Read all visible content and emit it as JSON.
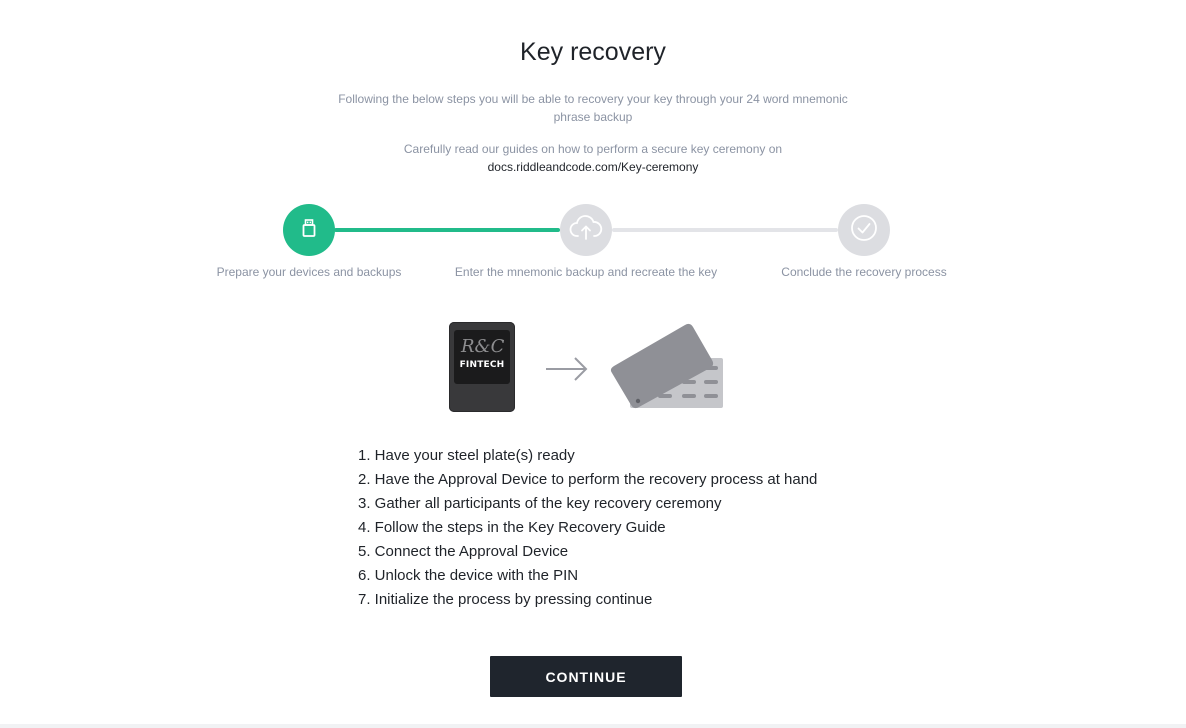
{
  "header": {
    "title": "Key recovery",
    "subtitle": "Following the below steps you will be able to recovery your key through your 24 word mnemonic phrase backup",
    "guide_text": "Carefully read our guides on how to perform a secure key ceremony on",
    "guide_link": "docs.riddleandcode.com/Key-ceremony"
  },
  "stepper": {
    "steps": [
      {
        "label": "Prepare your devices and backups",
        "icon": "usb-icon",
        "state": "active"
      },
      {
        "label": "Enter the mnemonic backup and recreate the key",
        "icon": "cloud-upload-icon",
        "state": "inactive"
      },
      {
        "label": "Conclude the recovery process",
        "icon": "check-circle-icon",
        "state": "inactive"
      }
    ],
    "colors": {
      "active": "#21bb8a",
      "inactive": "#dcdde1"
    }
  },
  "illustration": {
    "device_logo": "FINTECH",
    "device_script": "R&C"
  },
  "instructions": [
    "1. Have your steel plate(s) ready",
    "2. Have the Approval Device to perform the recovery process at hand",
    "3. Gather all participants of the key recovery ceremony",
    "4. Follow the steps in the Key Recovery Guide",
    "5. Connect the Approval Device",
    "6. Unlock the device with the PIN",
    "7. Initialize the process by pressing continue"
  ],
  "actions": {
    "continue_label": "CONTINUE"
  }
}
